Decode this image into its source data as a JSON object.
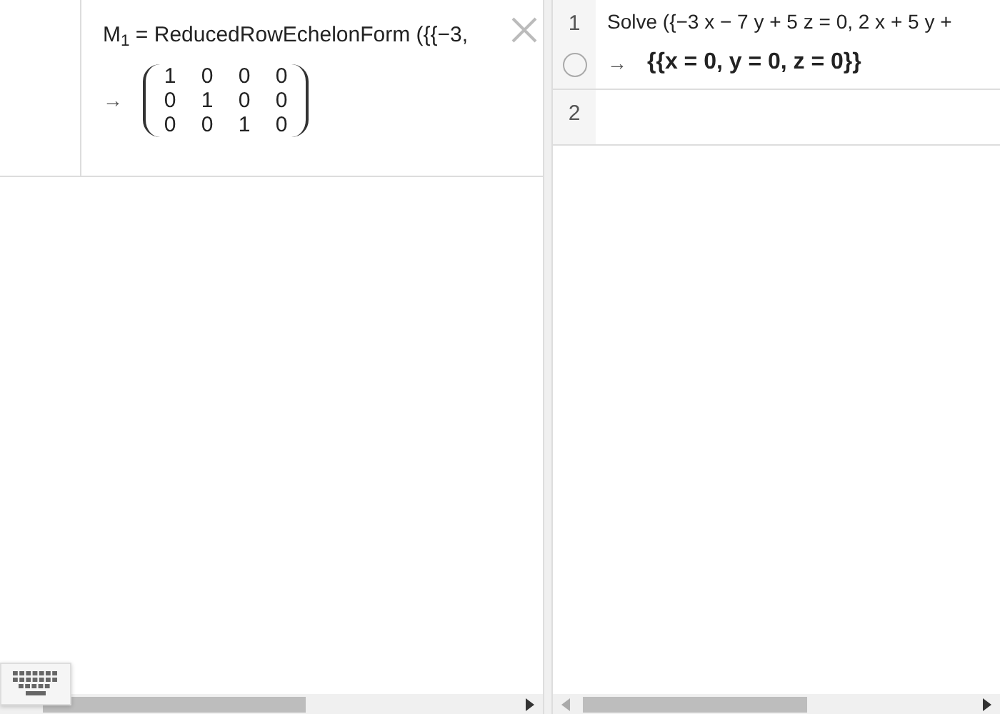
{
  "algebra_view": {
    "items": [
      {
        "definition": "M$_{1}$ = ReducedRowEchelonForm ({{−3,",
        "output_arrow": "→",
        "matrix": [
          [
            "1",
            "0",
            "0",
            "0"
          ],
          [
            "0",
            "1",
            "0",
            "0"
          ],
          [
            "0",
            "0",
            "1",
            "0"
          ]
        ]
      }
    ]
  },
  "cas_view": {
    "rows": [
      {
        "number": "1",
        "input": "Solve ({−3 x − 7 y + 5 z = 0, 2 x + 5 y +",
        "output_arrow": "→",
        "output": "{{x = 0, y = 0, z = 0}}",
        "toggle_on": false
      },
      {
        "number": "2",
        "input": "",
        "output": ""
      }
    ]
  }
}
